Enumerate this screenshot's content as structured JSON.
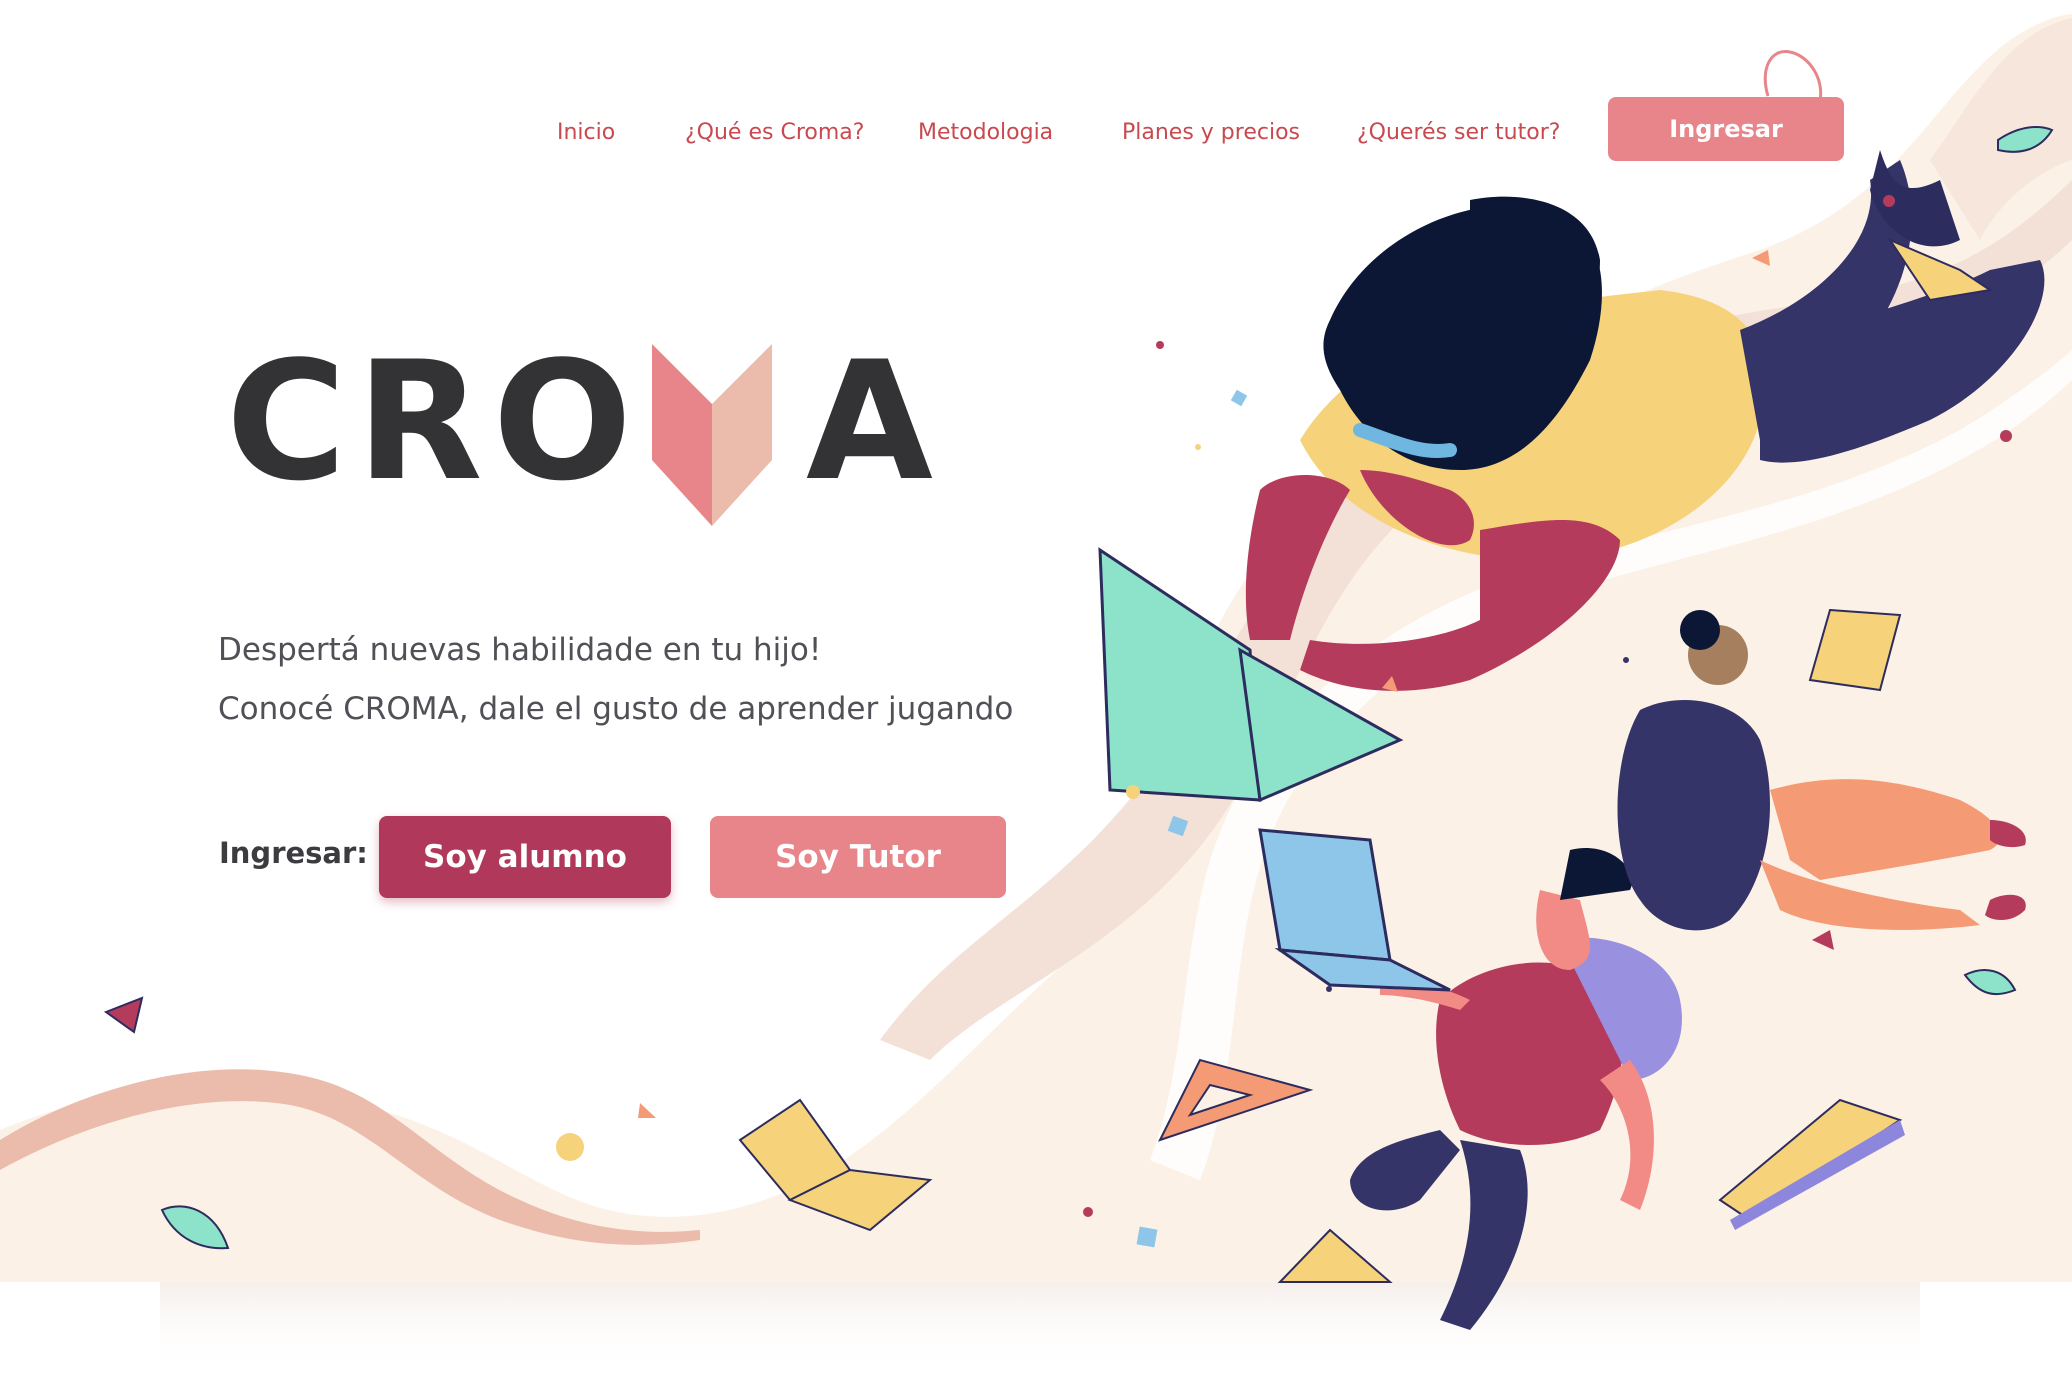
{
  "nav": {
    "items": [
      {
        "label": "Inicio"
      },
      {
        "label": "¿Qué es Croma?"
      },
      {
        "label": "Metodologia"
      },
      {
        "label": "Planes y precios"
      },
      {
        "label": "¿Querés ser tutor?"
      }
    ],
    "login_label": "Ingresar"
  },
  "hero": {
    "logo_left": "CRO",
    "logo_right": "A",
    "tagline_line1": "Despertá nuevas habilidade en tu hijo!",
    "tagline_line2": "Conocé CROMA, dale el gusto de aprender jugando",
    "cta_label": "Ingresar:",
    "student_button": "Soy alumno",
    "tutor_button": "Soy Tutor"
  },
  "colors": {
    "accent": "#e8858a",
    "primary": "#b0385a",
    "text_dark": "#333335",
    "cream": "#fbf1e7",
    "peach": "#ebbcac"
  }
}
